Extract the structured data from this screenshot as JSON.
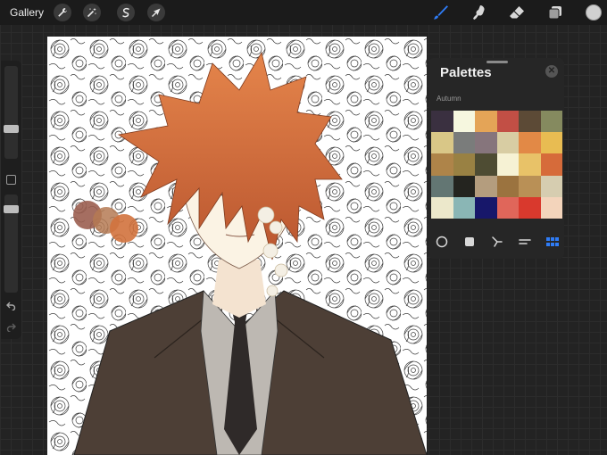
{
  "topbar": {
    "gallery_label": "Gallery",
    "left_tools": [
      "wrench-icon",
      "magic-wand-icon",
      "selection-icon",
      "transform-arrow-icon"
    ],
    "right_tools": [
      "brush-icon",
      "smudge-icon",
      "eraser-icon",
      "layers-icon"
    ],
    "active_color": "#d0d0d0",
    "active_tool_color": "#2f7cf6"
  },
  "sidebar": {
    "brush_size_level": 0.62,
    "opacity_level": 0.88,
    "undo_icon": "undo-icon",
    "redo_icon": "redo-icon"
  },
  "canvas": {
    "description_icon": "artwork-canvas"
  },
  "palettes": {
    "title": "Palettes",
    "palette_name": "Autumn",
    "swatches": [
      "#3a3040",
      "#f6f7df",
      "#e4a457",
      "#c24f45",
      "#5c4a36",
      "#858a5f",
      "#d9c787",
      "#7a7c7b",
      "#86757c",
      "#d8cda3",
      "#e28946",
      "#e8bc52",
      "#ae8449",
      "#998143",
      "#4e4c33",
      "#f6f2d4",
      "#e8c268",
      "#d66b3a",
      "#637673",
      "#24241f",
      "#b49d7e",
      "#9b733f",
      "#b99056",
      "#d6cdb0",
      "#ece8cb",
      "#8ab6b5",
      "#17176a",
      "#e0665a",
      "#d9392d",
      "#f3d4bb"
    ],
    "tabs": [
      "cards-icon",
      "classic-icon",
      "harmony-icon",
      "value-icon",
      "palettes-icon"
    ],
    "active_tab_color": "#2f7cf6"
  }
}
